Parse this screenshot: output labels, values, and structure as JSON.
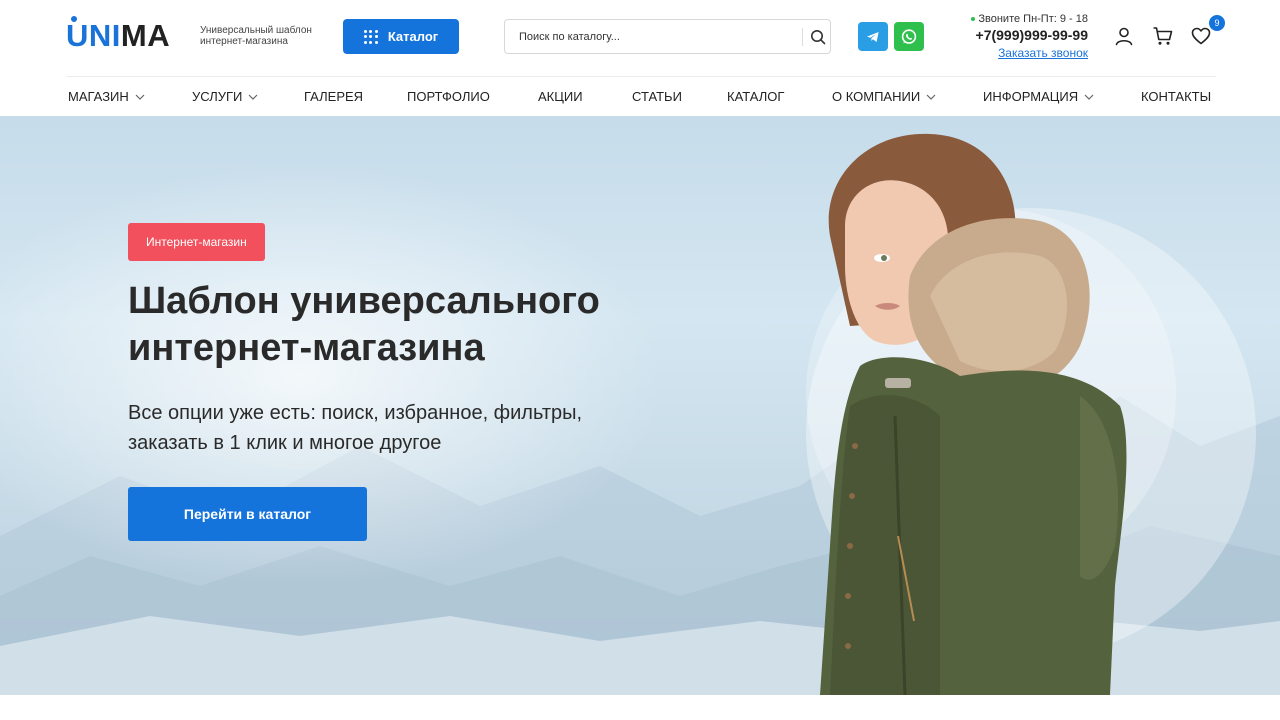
{
  "header": {
    "logo": {
      "part1": "UNI",
      "part2": "MA"
    },
    "tagline": "Универсальный шаблон интернет-магазина",
    "catalog_button": "Каталог",
    "search": {
      "placeholder": "Поиск по каталогу..."
    },
    "contacts": {
      "hours": "Звоните Пн-Пт: 9 - 18",
      "phone": "+7(999)999-99-99",
      "callback": "Заказать звонок"
    },
    "favorites_count": "9"
  },
  "nav": {
    "items": [
      {
        "label": "МАГАЗИН",
        "dropdown": true
      },
      {
        "label": "УСЛУГИ",
        "dropdown": true
      },
      {
        "label": "ГАЛЕРЕЯ",
        "dropdown": false
      },
      {
        "label": "ПОРТФОЛИО",
        "dropdown": false
      },
      {
        "label": "АКЦИИ",
        "dropdown": false
      },
      {
        "label": "СТАТЬИ",
        "dropdown": false
      },
      {
        "label": "КАТАЛОГ",
        "dropdown": false
      },
      {
        "label": "О КОМПАНИИ",
        "dropdown": true
      },
      {
        "label": "ИНФОРМАЦИЯ",
        "dropdown": true
      },
      {
        "label": "КОНТАКТЫ",
        "dropdown": false
      }
    ]
  },
  "hero": {
    "badge": "Интернет-магазин",
    "title_line1": "Шаблон универсального",
    "title_line2": "интернет-магазина",
    "subtitle_line1": "Все опции уже есть: поиск, избранное, фильтры,",
    "subtitle_line2": "заказать в 1 клик и многое другое",
    "button": "Перейти в каталог"
  },
  "icons": {
    "catalog": "grid-dots-icon",
    "search": "search-icon",
    "telegram": "telegram-icon",
    "whatsapp": "whatsapp-icon",
    "account": "user-icon",
    "cart": "cart-icon",
    "favorites": "heart-icon"
  },
  "colors": {
    "accent": "#1573dc",
    "badge": "#f1505c",
    "telegram": "#2a9ee5",
    "whatsapp": "#2fbf4d"
  }
}
